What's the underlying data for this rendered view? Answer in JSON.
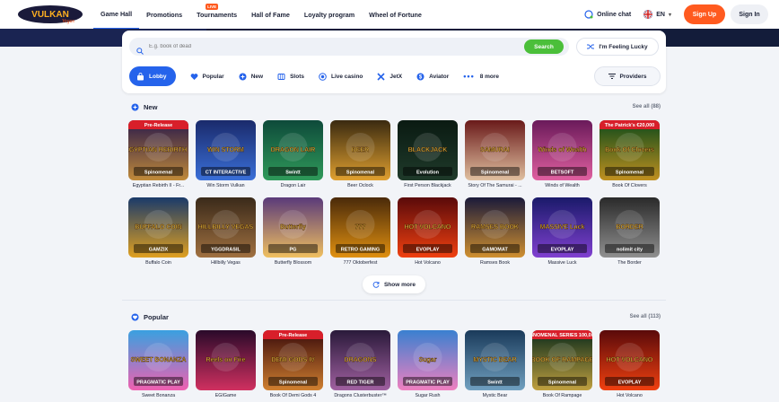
{
  "header": {
    "logo": "Vulkan Vegas",
    "nav": [
      {
        "label": "Game Hall",
        "active": true
      },
      {
        "label": "Promotions"
      },
      {
        "label": "Tournaments",
        "badge": "LIVE"
      },
      {
        "label": "Hall of Fame"
      },
      {
        "label": "Loyalty program"
      },
      {
        "label": "Wheel of Fortune"
      }
    ],
    "online_chat": "Online chat",
    "language": "EN",
    "sign_up": "Sign Up",
    "sign_in": "Sign In"
  },
  "search": {
    "placeholder": "E.g. book of dead",
    "button": "Search",
    "lucky": "I'm Feeling Lucky"
  },
  "categories": [
    {
      "label": "Lobby",
      "icon": "bag-icon",
      "active": true
    },
    {
      "label": "Popular",
      "icon": "heart-icon"
    },
    {
      "label": "New",
      "icon": "plus-icon"
    },
    {
      "label": "Slots",
      "icon": "slots-icon"
    },
    {
      "label": "Live casino",
      "icon": "live-icon"
    },
    {
      "label": "JetX",
      "icon": "jetx-icon"
    },
    {
      "label": "Aviator",
      "icon": "aviator-icon"
    }
  ],
  "more_label": "8 more",
  "providers_label": "Providers",
  "sections": {
    "new": {
      "title": "New",
      "see_all": "See all (88)",
      "row1": [
        {
          "name": "Egyptian Rebirth II - Fr...",
          "c1": "#2b1a4a",
          "c2": "#c08a3a",
          "badge": "Pre-Release",
          "label": "EGYPTIAN REBIRTH II",
          "provider": "Spinomenal"
        },
        {
          "name": "Win Storm Vulkan",
          "c1": "#1a2a6b",
          "c2": "#3a6fd8",
          "label": "WIN STORM",
          "provider": "CT INTERACTIVE"
        },
        {
          "name": "Dragon Lair",
          "c1": "#0e4a3a",
          "c2": "#2f9a5a",
          "label": "DRAGON LAIR",
          "provider": "Swintt"
        },
        {
          "name": "Beer Oclock",
          "c1": "#3a2a10",
          "c2": "#e0a030",
          "label": "BEER",
          "provider": "Spinomenal"
        },
        {
          "name": "First Person Blackjack",
          "c1": "#0a1a12",
          "c2": "#1f3a2a",
          "label": "BLACKJACK",
          "provider": "Evolution"
        },
        {
          "name": "Story Of The Samurai - ...",
          "c1": "#6a1a1a",
          "c2": "#e0c0a0",
          "label": "SAMURAI",
          "provider": "Spinomenal"
        },
        {
          "name": "Winds of Wealth",
          "c1": "#6a1a5a",
          "c2": "#e060a0",
          "label": "Winds of Wealth",
          "provider": "BETSOFT"
        },
        {
          "name": "Book Of Clovers",
          "c1": "#0e4a1a",
          "c2": "#c09020",
          "badge": "The Patrick's €20,000",
          "label": "Book Of Clovers",
          "provider": "Spinomenal"
        }
      ],
      "row2": [
        {
          "name": "Buffalo Coin",
          "c1": "#1a3a6a",
          "c2": "#e0a020",
          "label": "BUFFALO COIN",
          "provider": "GAMZIX"
        },
        {
          "name": "Hillbilly Vegas",
          "c1": "#3a2a1a",
          "c2": "#a07040",
          "label": "HILLBILLY VEGAS",
          "provider": "YGGDRASIL"
        },
        {
          "name": "Butterfly Blossom",
          "c1": "#5a3a7a",
          "c2": "#f0c060",
          "label": "Butterfly",
          "provider": "PG"
        },
        {
          "name": "777 Oktoberfest",
          "c1": "#4a2a0a",
          "c2": "#e09010",
          "label": "777",
          "provider": "RETRO GAMING"
        },
        {
          "name": "Hot Volcano",
          "c1": "#5a0a0a",
          "c2": "#f04010",
          "label": "HOT VOLCANO",
          "provider": "EVOPLAY"
        },
        {
          "name": "Ramses Book",
          "c1": "#1a1a3a",
          "c2": "#d09030",
          "label": "RAMSES BOOK",
          "provider": "GAMOMAT"
        },
        {
          "name": "Massive Luck",
          "c1": "#1a1a6a",
          "c2": "#8040d0",
          "label": "MASSIVE Luck",
          "provider": "EVOPLAY"
        },
        {
          "name": "The Border",
          "c1": "#2a2a2a",
          "c2": "#909090",
          "label": "BORDER",
          "provider": "nolimit city"
        }
      ]
    },
    "show_more": "Show more",
    "popular": {
      "title": "Popular",
      "see_all": "See all (113)",
      "row1": [
        {
          "name": "Sweet Bonanza",
          "c1": "#3aa0e0",
          "c2": "#f060b0",
          "label": "SWEET BONANZA",
          "provider": "PRAGMATIC PLAY"
        },
        {
          "name": "EGIGame",
          "c1": "#2a0a2a",
          "c2": "#d03060",
          "label": "Reels on Fire",
          "provider": ""
        },
        {
          "name": "Book Of Demi Gods 4",
          "c1": "#3a0a0a",
          "c2": "#d08030",
          "badge": "Pre-Release",
          "label": "DEMI GODS IV",
          "provider": "Spinomenal"
        },
        {
          "name": "Dragons Clusterbuster™",
          "c1": "#2a1a3a",
          "c2": "#a060a0",
          "label": "DRAGONS",
          "provider": "RED TIGER"
        },
        {
          "name": "Sugar Rush",
          "c1": "#3a80d0",
          "c2": "#f080c0",
          "label": "Sugar",
          "provider": "PRAGMATIC PLAY"
        },
        {
          "name": "Mystic Bear",
          "c1": "#1a3a5a",
          "c2": "#70a0c0",
          "label": "MYSTIC BEAR",
          "provider": "Swintt"
        },
        {
          "name": "Book Of Rampage",
          "c1": "#0a2a1a",
          "c2": "#c0a040",
          "badge": "SPINOMENAL SERIES 100,000€",
          "label": "BOOK OF RAMPAGE",
          "provider": "Spinomenal"
        },
        {
          "name": "Hot Volcano",
          "c1": "#5a0a0a",
          "c2": "#f04010",
          "label": "HOT VOLCANO",
          "provider": "EVOPLAY"
        }
      ]
    }
  }
}
